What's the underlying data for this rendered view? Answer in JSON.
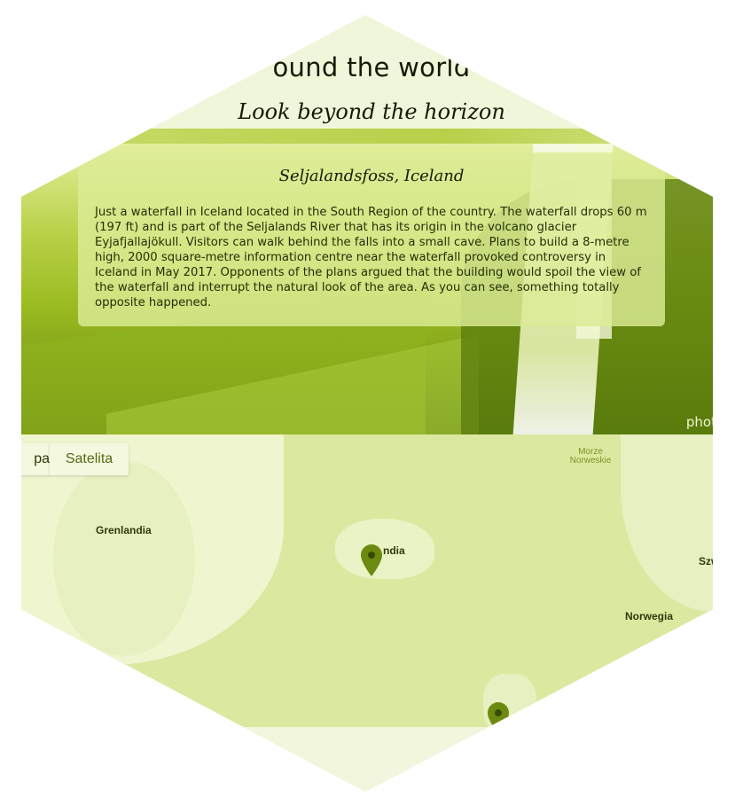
{
  "header": {
    "site_title": "ound the world",
    "tagline": "Look beyond the horizon"
  },
  "featured": {
    "title": "Seljalandsfoss, Iceland",
    "description": "Just a waterfall in Iceland located in the South Region of the country. The waterfall drops 60 m (197 ft) and is part of the Seljalands River that has its origin in the volcano glacier Eyjafjallajökull. Visitors can walk behind the falls into a small cave. Plans to build a 8-metre high, 2000 square-metre information centre near the waterfall provoked controversy in Iceland in May 2017. Opponents of the plans argued that the building would spoil the view of the waterfall and interrupt the natural look of the area. As you can see, something totally opposite happened.",
    "photo_credit": "phot"
  },
  "map": {
    "type_buttons": [
      "pa",
      "Satelita"
    ],
    "labels": {
      "greenland": "Grenlandia",
      "iceland": "ndia",
      "norway": "Norwegia",
      "sweden": "Szw",
      "sea": "Morze\nNorweskie"
    },
    "marker_icons": [
      "map-pin-icon",
      "map-pin-icon"
    ]
  },
  "colors": {
    "accent": "#b7d04a",
    "marker": "#6d8a10",
    "text": "#151a05"
  }
}
